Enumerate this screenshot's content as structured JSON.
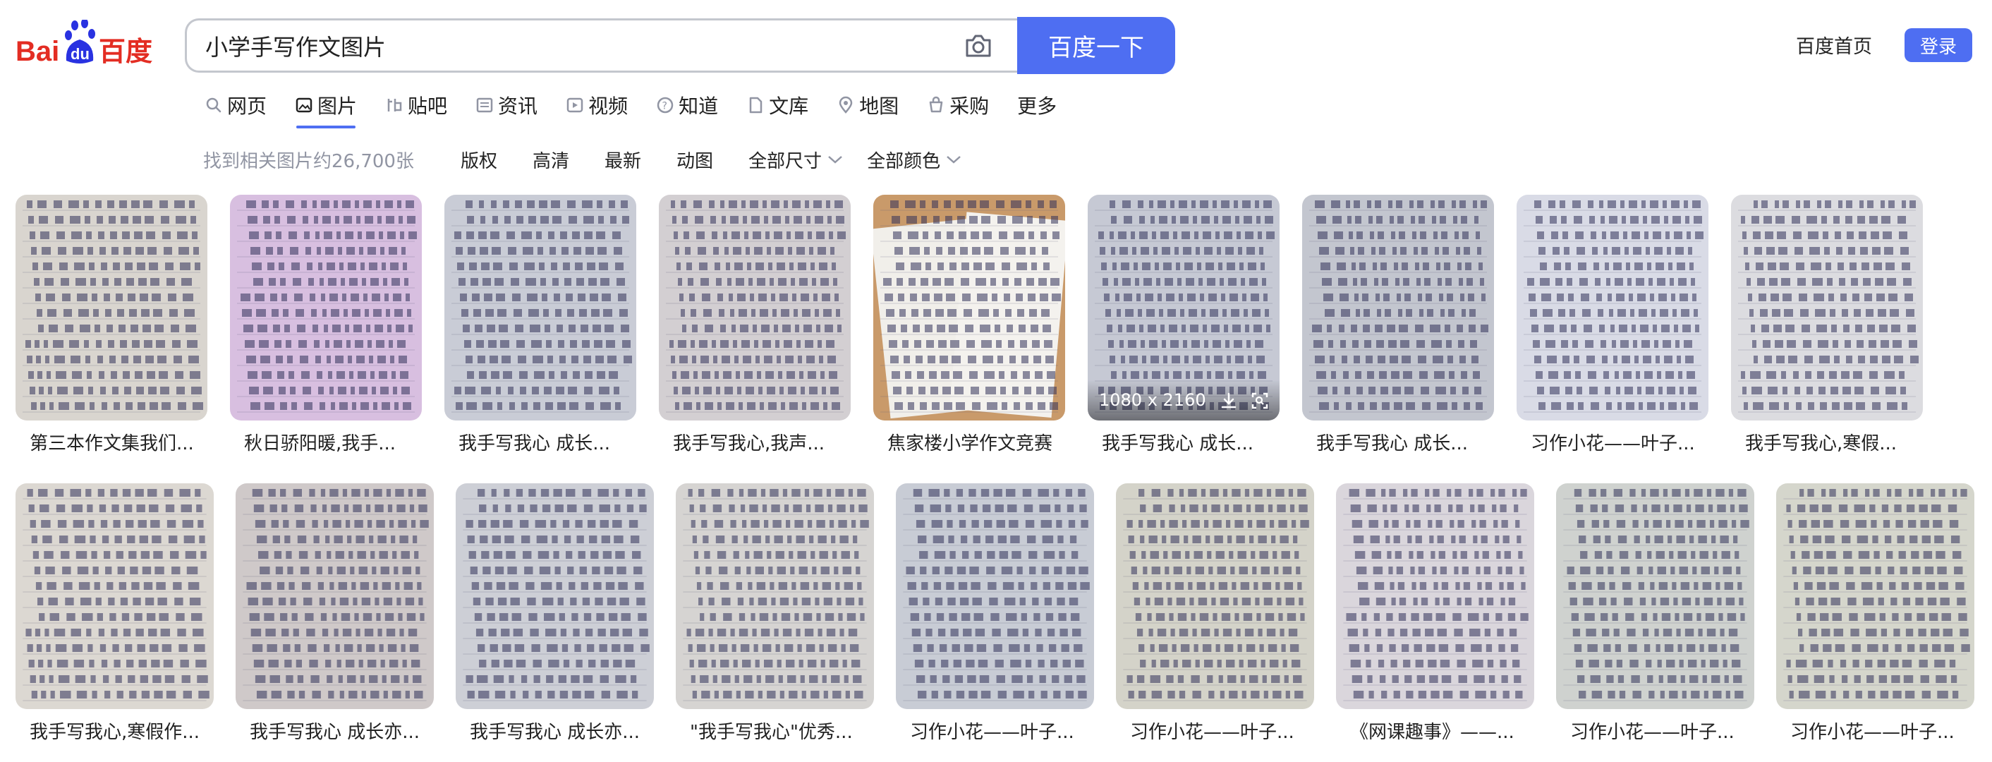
{
  "header": {
    "search_query": "小学手写作文图片",
    "search_button_label": "百度一下",
    "home_link": "百度首页",
    "login_label": "登录"
  },
  "tabs": [
    {
      "label": "网页",
      "icon": "search-icon"
    },
    {
      "label": "图片",
      "icon": "image-icon",
      "active": true
    },
    {
      "label": "贴吧",
      "icon": "tieba-icon"
    },
    {
      "label": "资讯",
      "icon": "news-icon"
    },
    {
      "label": "视频",
      "icon": "video-icon"
    },
    {
      "label": "知道",
      "icon": "question-icon"
    },
    {
      "label": "文库",
      "icon": "doc-icon"
    },
    {
      "label": "地图",
      "icon": "map-pin-icon"
    },
    {
      "label": "采购",
      "icon": "cart-icon"
    },
    {
      "label": "更多",
      "icon": ""
    }
  ],
  "filters": {
    "result_count": "找到相关图片约26,700张",
    "items": [
      "版权",
      "高清",
      "最新",
      "动图",
      "全部尺寸",
      "全部颜色"
    ]
  },
  "results": {
    "row1": [
      {
        "caption": "第三本作文集我们..."
      },
      {
        "caption": "秋日骄阳暖,我手..."
      },
      {
        "caption": "我手写我心 成长..."
      },
      {
        "caption": "我手写我心,我声..."
      },
      {
        "caption": "焦家楼小学作文竞赛"
      },
      {
        "caption": "我手写我心 成长...",
        "size": "1080 x 2160"
      },
      {
        "caption": "我手写我心 成长..."
      },
      {
        "caption": "习作小花——叶子..."
      },
      {
        "caption": "我手写我心,寒假..."
      }
    ],
    "row2": [
      {
        "caption": "我手写我心,寒假作..."
      },
      {
        "caption": "我手写我心 成长亦..."
      },
      {
        "caption": "我手写我心 成长亦..."
      },
      {
        "caption": "\"我手写我心\"优秀..."
      },
      {
        "caption": "习作小花——叶子..."
      },
      {
        "caption": "习作小花——叶子..."
      },
      {
        "caption": "《网课趣事》——..."
      },
      {
        "caption": "习作小花——叶子..."
      },
      {
        "caption": "习作小花——叶子..."
      }
    ]
  },
  "colors": {
    "brand_blue": "#4e6ef2",
    "brand_red": "#e32d23",
    "muted_text": "#9195a3"
  }
}
